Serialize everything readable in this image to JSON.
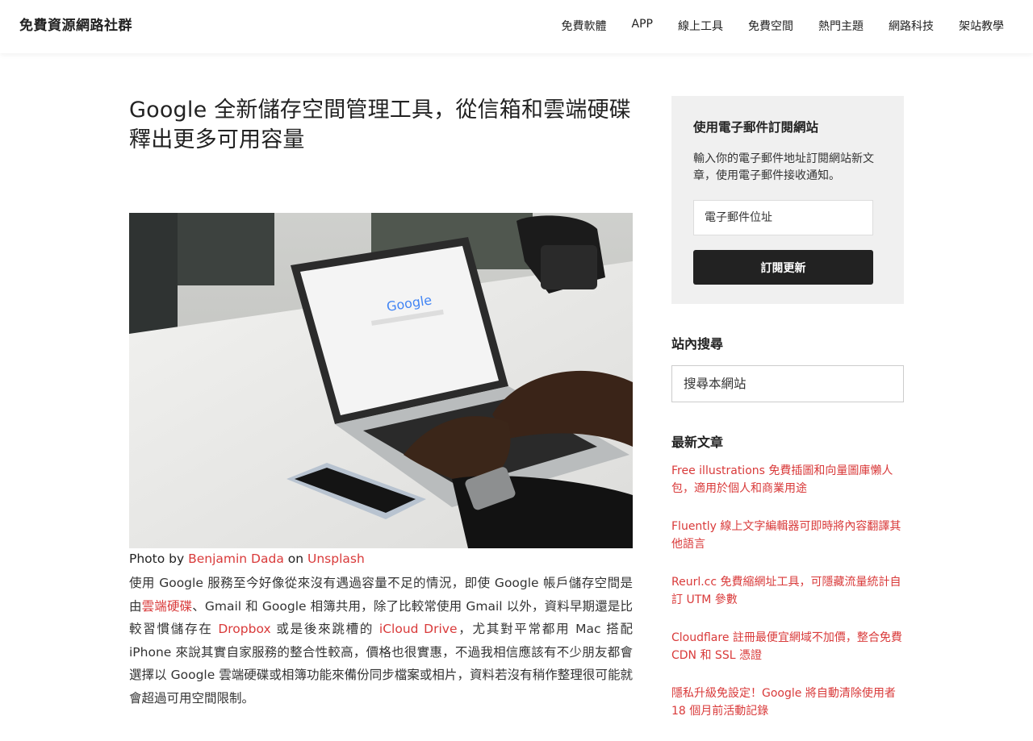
{
  "site": {
    "title": "免費資源網路社群"
  },
  "nav": {
    "items": [
      "免費軟體",
      "APP",
      "線上工具",
      "免費空間",
      "熱門主題",
      "網路科技",
      "架站教學"
    ]
  },
  "post": {
    "title": "Google 全新儲存空間管理工具，從信箱和雲端硬碟釋出更多可用容量",
    "caption": {
      "prefix": "Photo by ",
      "author": "Benjamin Dada",
      "middle": " on ",
      "source": "Unsplash"
    },
    "body": {
      "t1": "使用 Google 服務至今好像從來沒有遇過容量不足的情況，即使 Google 帳戶儲存空間是由",
      "link1": "雲端硬碟",
      "t2": "、Gmail 和 Google 相簿共用，除了比較常使用 Gmail 以外，資料早期還是比較習慣儲存在 ",
      "link2": "Dropbox",
      "t3": " 或是後來跳槽的 ",
      "link3": "iCloud Drive",
      "t4": "，尤其對平常都用 Mac 搭配 iPhone 來說其實自家服務的整合性較高，價格也很實惠，不過我相信應該有不少朋友都會選擇以 Google 雲端硬碟或相簿功能來備份同步檔案或相片，資料若沒有稍作整理很可能就會超過可用空間限制。"
    }
  },
  "sidebar": {
    "subscribe": {
      "title": "使用電子郵件訂閱網站",
      "description": "輸入你的電子郵件地址訂閱網站新文章，使用電子郵件接收通知。",
      "email_placeholder": "電子郵件位址",
      "button_label": "訂閱更新"
    },
    "search": {
      "title": "站內搜尋",
      "placeholder": "搜尋本網站"
    },
    "recent": {
      "title": "最新文章",
      "items": [
        "Free illustrations 免費插圖和向量圖庫懶人包，適用於個人和商業用途",
        "Fluently 線上文字編輯器可即時將內容翻譯其他語言",
        "Reurl.cc 免費縮網址工具，可隱藏流量統計自訂 UTM 參數",
        "Cloudflare 註冊最便宜網域不加價，整合免費 CDN 和 SSL 憑證",
        "隱私升級免設定！Google 將自動清除使用者 18 個月前活動記錄"
      ]
    }
  },
  "image": {
    "screen_logo": "Google"
  }
}
